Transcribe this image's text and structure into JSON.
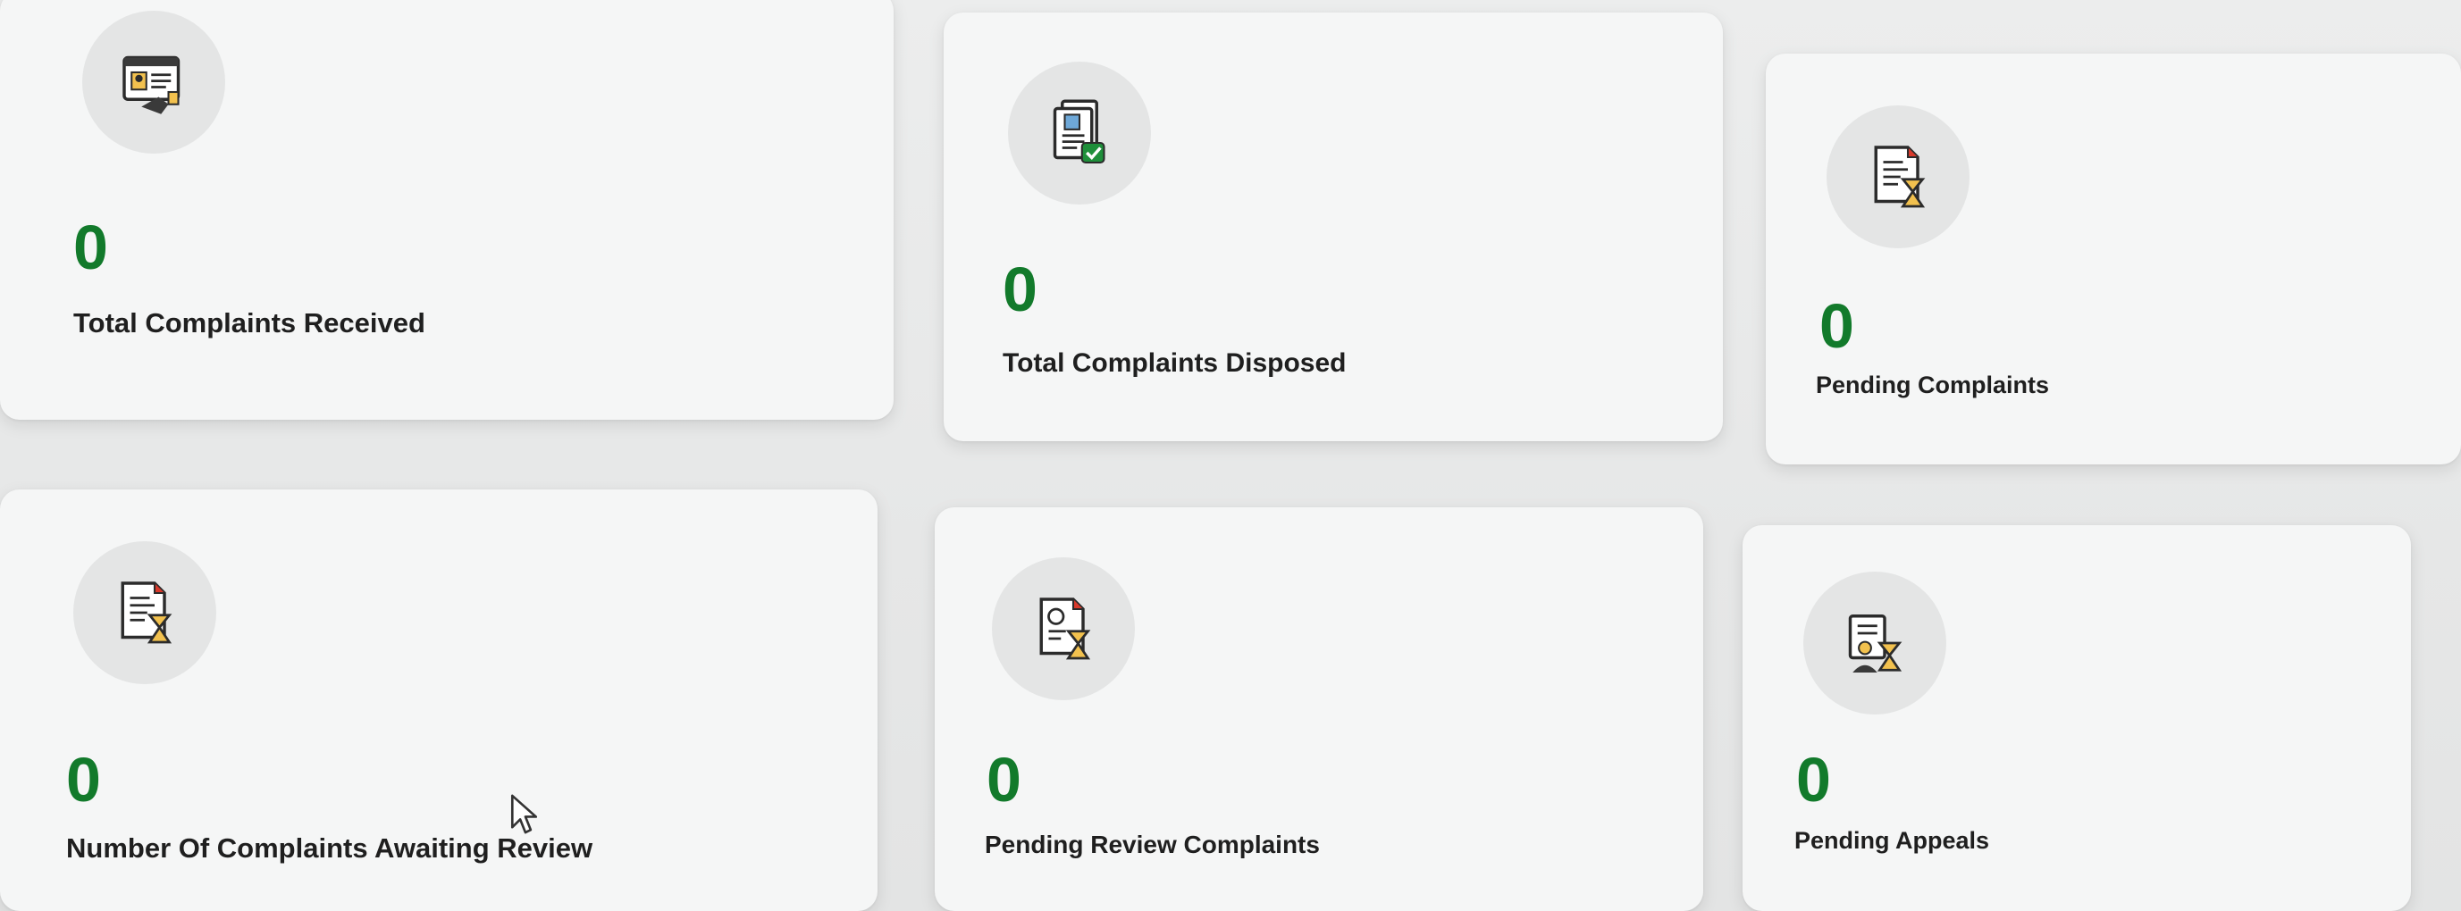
{
  "cards": [
    {
      "count": "0",
      "label": "Total Complaints Received",
      "icon": "id-card-icon"
    },
    {
      "count": "0",
      "label": "Total Complaints Disposed",
      "icon": "document-check-icon"
    },
    {
      "count": "0",
      "label": "Pending Complaints",
      "icon": "document-hourglass-icon"
    },
    {
      "count": "0",
      "label": "Number Of Complaints Awaiting Review",
      "icon": "document-hourglass-icon"
    },
    {
      "count": "0",
      "label": "Pending Review Complaints",
      "icon": "review-hourglass-icon"
    },
    {
      "count": "0",
      "label": "Pending Appeals",
      "icon": "appeal-hourglass-icon"
    }
  ],
  "colors": {
    "count": "#127a2b",
    "accent_red": "#d9392b",
    "accent_green": "#1e8f3a"
  }
}
